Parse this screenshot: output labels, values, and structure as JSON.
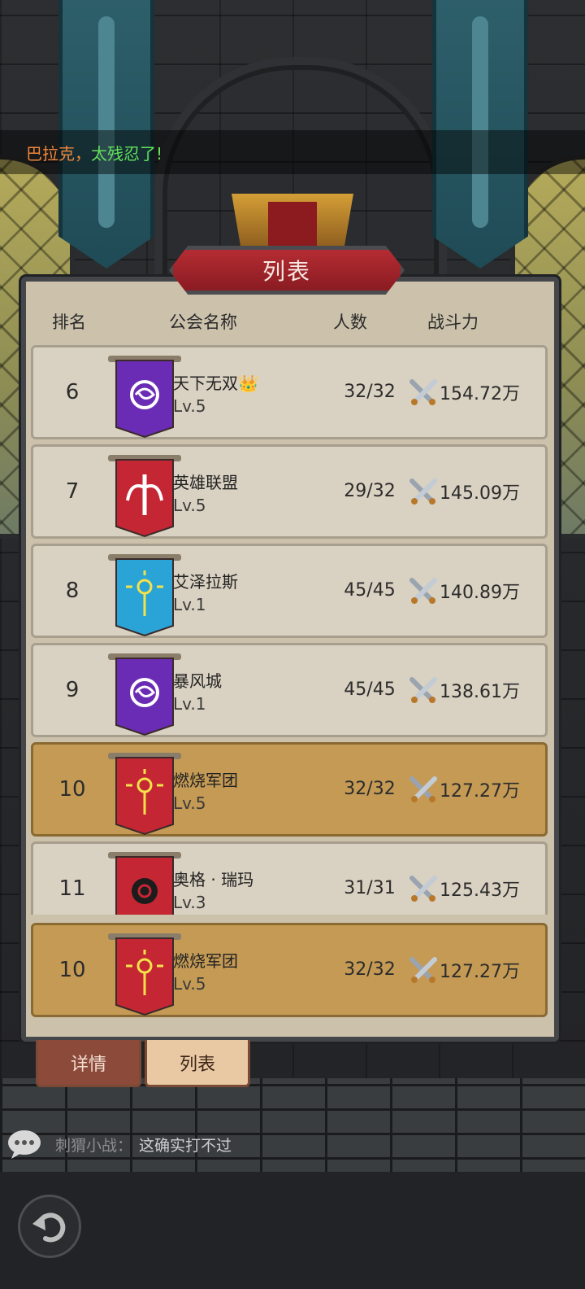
{
  "top_message": {
    "speaker": "巴拉克，",
    "text": "太残忍了!"
  },
  "panel": {
    "title": "列表"
  },
  "columns": {
    "rank": "排名",
    "name": "公会名称",
    "members": "人数",
    "power": "战斗力"
  },
  "guilds": [
    {
      "rank": "6",
      "name": "天下无双",
      "crown": "👑",
      "level": "Lv.5",
      "members": "32/32",
      "power": "154.72万",
      "flag_color": "#6b2cb5",
      "emblem": "rose-emblem-icon"
    },
    {
      "rank": "7",
      "name": "英雄联盟",
      "crown": "",
      "level": "Lv.5",
      "members": "29/32",
      "power": "145.09万",
      "flag_color": "#c42733",
      "emblem": "winged-sword-emblem-icon"
    },
    {
      "rank": "8",
      "name": "艾泽拉斯",
      "crown": "",
      "level": "Lv.1",
      "members": "45/45",
      "power": "140.89万",
      "flag_color": "#2aa3d6",
      "emblem": "sun-emblem-icon"
    },
    {
      "rank": "9",
      "name": "暴风城",
      "crown": "",
      "level": "Lv.1",
      "members": "45/45",
      "power": "138.61万",
      "flag_color": "#6b2cb5",
      "emblem": "rose-emblem-icon"
    },
    {
      "rank": "10",
      "name": "燃烧军团",
      "crown": "",
      "level": "Lv.5",
      "members": "32/32",
      "power": "127.27万",
      "flag_color": "#c42733",
      "emblem": "sun-emblem-icon",
      "highlight": true
    },
    {
      "rank": "11",
      "name": "奥格 · 瑞玛",
      "crown": "",
      "level": "Lv.3",
      "members": "31/31",
      "power": "125.43万",
      "flag_color": "#c42733",
      "emblem": "spiral-emblem-icon"
    }
  ],
  "my_guild": {
    "rank": "10",
    "name": "燃烧军团",
    "level": "Lv.5",
    "members": "32/32",
    "power": "127.27万",
    "flag_color": "#c42733",
    "emblem": "sun-emblem-icon"
  },
  "tabs": {
    "detail": "详情",
    "list": "列表"
  },
  "chat": {
    "user": "刺猬小战：",
    "text": "这确实打不过"
  },
  "colors": {
    "highlight_row": "#c49a55",
    "normal_row": "#d9d1c1",
    "title_plate": "#b52c33"
  }
}
